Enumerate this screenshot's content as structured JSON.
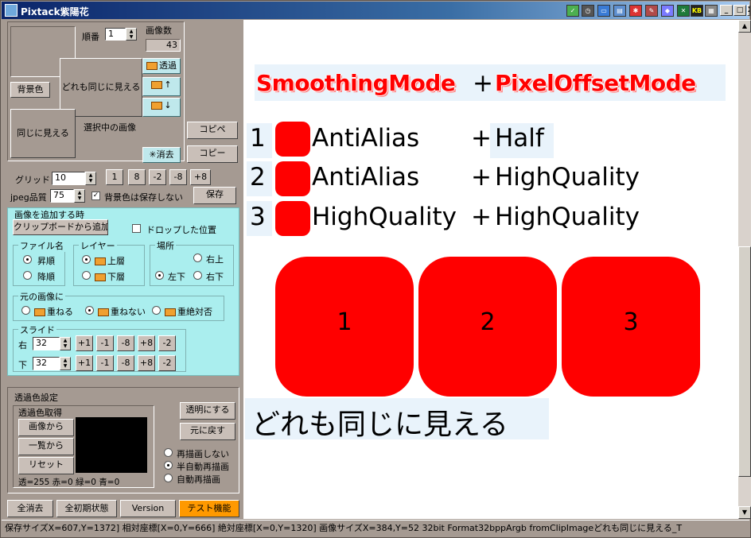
{
  "window": {
    "title": "Pixtack紫陽花"
  },
  "titlebar": {
    "minimize": "_",
    "maximize": "□",
    "close": "X",
    "tray_kb": "KB"
  },
  "top": {
    "order_label": "順番",
    "order_value": "1",
    "image_count_label": "画像数",
    "image_count": "43",
    "bg_color_btn": "背景色",
    "all_same_text": "どれも同じに見える",
    "same_look_text": "同じに見える",
    "transparent_btn": "透過",
    "selected_label": "選択中の画像",
    "copy_paste_btn": "コピペ",
    "clear_btn": "消去",
    "copy_btn": "コピー"
  },
  "grid": {
    "label": "グリッド",
    "value": "10",
    "steps": [
      "1",
      "8",
      "-2",
      "-8",
      "+8"
    ]
  },
  "jpeg": {
    "label": "jpeg品質",
    "value": "75",
    "bg_checkbox": "背景色は保存しない",
    "save_btn": "保存"
  },
  "add": {
    "title": "画像を追加する時",
    "clipboard_btn": "クリップボードから追加",
    "drop_checkbox": "ドロップした位置",
    "filename": {
      "title": "ファイル名",
      "asc": "昇順",
      "desc": "降順"
    },
    "layer": {
      "title": "レイヤー",
      "top": "上層",
      "bottom": "下層"
    },
    "place": {
      "title": "場所",
      "top_right": "右上",
      "bottom_left": "左下",
      "bottom_right": "右下"
    },
    "orig": {
      "title": "元の画像に",
      "overlap": "重ねる",
      "no_overlap": "重ねない",
      "never": "重絶対否"
    },
    "slide": {
      "title": "スライド",
      "right": "右",
      "down": "下",
      "right_value": "32",
      "down_value": "32",
      "steps": [
        "+1",
        "-1",
        "-8",
        "+8",
        "-2"
      ]
    }
  },
  "trans": {
    "title": "透過色設定",
    "get_title": "透過色取得",
    "from_image": "画像から",
    "from_list": "一覧から",
    "reset": "リセット",
    "info": "透=255 赤=0 緑=0 青=0",
    "make_transparent": "透明にする",
    "restore": "元に戻す",
    "redraw_none": "再描画しない",
    "redraw_semi": "半自動再描画",
    "redraw_auto": "自動再描画"
  },
  "tabs": [
    "全消去",
    "全初期状態",
    "Version",
    "テスト機能"
  ],
  "canvas": {
    "heading_a": "SmoothingMode",
    "heading_plus": "+",
    "heading_b": "PixelOffsetMode",
    "rows": [
      {
        "num": "1",
        "smooth": "AntiAlias",
        "plus": "+",
        "offset": "Half"
      },
      {
        "num": "2",
        "smooth": "AntiAlias",
        "plus": "+",
        "offset": "HighQuality"
      },
      {
        "num": "3",
        "smooth": "HighQuality",
        "plus": "+",
        "offset": "HighQuality"
      }
    ],
    "boxes": [
      "1",
      "2",
      "3"
    ],
    "footer": "どれも同じに見える",
    "accent": "#ff0000"
  },
  "status": "保存サイズX=607,Y=1372]  相対座標[X=0,Y=666]  絶対座標[X=0,Y=1320]  画像サイズX=384,Y=52  32bit  Format32bppArgb  fromClipImageどれも同じに見える_T"
}
